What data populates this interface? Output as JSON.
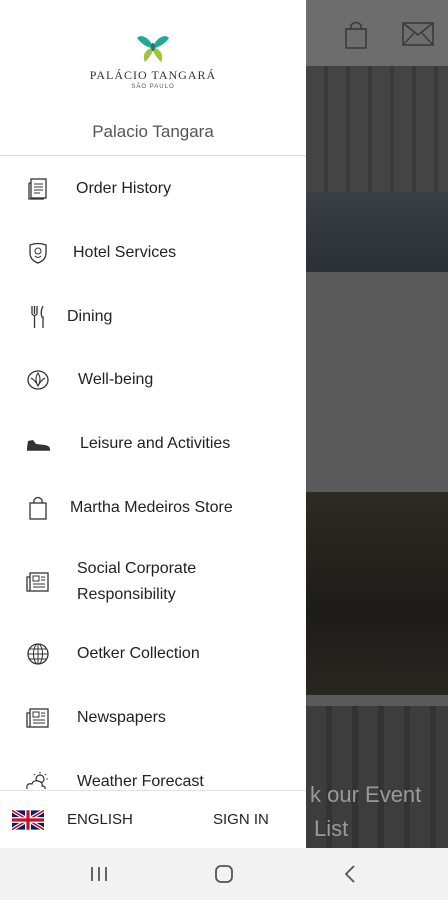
{
  "drawer": {
    "logo_name": "PALÁCIO TANGARÁ",
    "logo_city": "SÃO PAULO",
    "hotel_name": "Palacio Tangara"
  },
  "menu": [
    {
      "label": "Order History",
      "icon": "receipt-icon"
    },
    {
      "label": "Hotel Services",
      "icon": "shield-crest-icon"
    },
    {
      "label": "Dining",
      "icon": "fork-knife-icon"
    },
    {
      "label": "Well-being",
      "icon": "lotus-icon"
    },
    {
      "label": "Leisure and Activities",
      "icon": "sneaker-icon"
    },
    {
      "label": "Martha Medeiros Store",
      "icon": "shopping-bag-icon"
    },
    {
      "label": "Social Corporate\nResponsibility",
      "icon": "newspaper-icon"
    },
    {
      "label": "Oetker Collection",
      "icon": "globe-icon"
    },
    {
      "label": "Newspapers",
      "icon": "newspaper-icon"
    },
    {
      "label": "Weather Forecast",
      "icon": "sun-cloud-icon"
    }
  ],
  "footer": {
    "language": "ENGLISH",
    "sign_in": "SIGN IN",
    "flag": "uk-flag-icon"
  },
  "background": {
    "event_text_line1": "k our Event",
    "event_text_line2": "List"
  },
  "navbar": {
    "recents": "recents-icon",
    "home": "home-icon",
    "back": "back-icon"
  },
  "colors": {
    "drawer_bg": "#ffffff",
    "scrim": "#5a5a5a",
    "text": "#222222",
    "logo_teal": "#1fa99a",
    "logo_lime": "#9cc53a"
  }
}
